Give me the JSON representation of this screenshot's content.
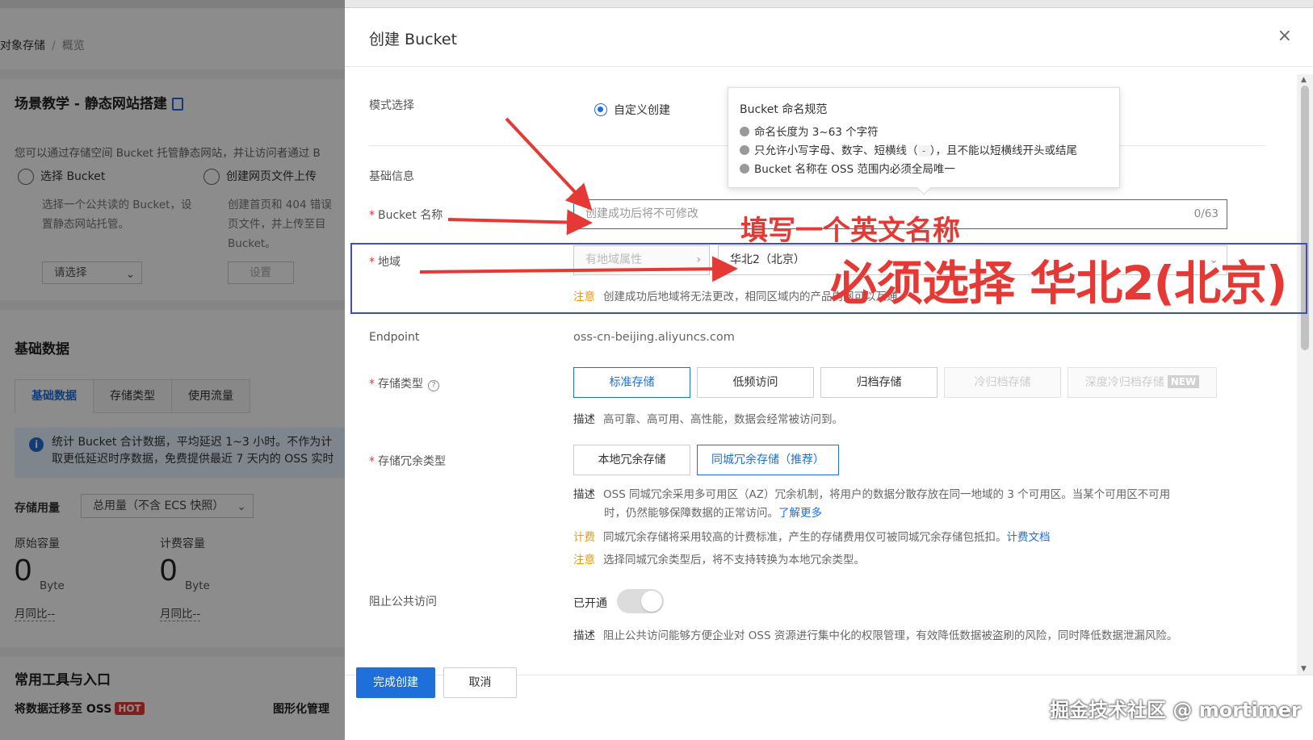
{
  "background": {
    "breadcrumb": {
      "root": "对象存储",
      "current": "概览"
    },
    "scene": {
      "title": "场景教学 - 静态网站搭建",
      "desc": "您可以通过存储空间 Bucket 托管静态网站，并让访问者通过 B",
      "step1": {
        "title": "选择 Bucket",
        "desc1": "选择一个公共读的 Bucket，设",
        "desc2": "置静态网站托管。",
        "button": "请选择"
      },
      "step2": {
        "title": "创建网页文件上传",
        "desc1": "创建首页和 404 错误",
        "desc2": "页文件，并上传至目",
        "desc3": "Bucket。",
        "button": "设置"
      }
    },
    "basic": {
      "title": "基础数据",
      "tabs": [
        "基础数据",
        "存储类型",
        "使用流量"
      ],
      "info1": "统计 Bucket 合计数据，平均延迟 1~3 小时。不作为计",
      "info2": "取更低延迟时序数据，免费提供最近 7 天内的 OSS 实时",
      "usage_label": "存储用量",
      "usage_select": "总用量（不含 ECS 快照）",
      "raw_label": "原始容量",
      "billing_label": "计费容量",
      "raw_value": "0",
      "billing_value": "0",
      "unit": "Byte",
      "mom": "月同比--"
    },
    "tools": {
      "title": "常用工具与入口",
      "item1": "将数据迁移至 OSS",
      "hot": "HOT",
      "item2": "图形化管理"
    }
  },
  "drawer": {
    "title": "创建 Bucket",
    "close": "×",
    "mode": {
      "label": "模式选择",
      "option": "自定义创建"
    },
    "tooltip": {
      "title": "Bucket 命名规范",
      "rule1": "命名长度为 3~63 个字符",
      "rule2a": "只允许小写字母、数字、短横线（",
      "rule2code": "-",
      "rule2b": "），且不能以短横线开头或结尾",
      "rule3": "Bucket 名称在 OSS 范围内必须全局唯一"
    },
    "basic_info": "基础信息",
    "bucket_name": {
      "label": "Bucket 名称",
      "placeholder": "创建成功后将不可修改",
      "count": "0/63"
    },
    "region": {
      "label": "地域",
      "attr_placeholder": "有地域属性",
      "value": "华北2（北京）",
      "note_key": "注意",
      "note": "创建成功后地域将无法更改，相同区域内的产品内网可以互通。"
    },
    "endpoint": {
      "label": "Endpoint",
      "value": "oss-cn-beijing.aliyuncs.com"
    },
    "storage_class": {
      "label": "存储类型",
      "help": "?",
      "options": [
        "标准存储",
        "低频访问",
        "归档存储",
        "冷归档存储",
        "深度冷归档存储"
      ],
      "new_badge": "NEW",
      "desc_key": "描述",
      "desc": "高可靠、高可用、高性能，数据会经常被访问到。"
    },
    "redundancy": {
      "label": "存储冗余类型",
      "options": [
        "本地冗余存储",
        "同城冗余存储（推荐）"
      ],
      "desc_key": "描述",
      "desc1": "OSS 同城冗余采用多可用区（AZ）冗余机制，将用户的数据分散存放在同一地域的 3 个可用区。当某个可用区不可用",
      "desc2": "时，仍然能够保障数据的正常访问。",
      "learn_more": "了解更多",
      "billing_key": "计费",
      "billing": "同城冗余存储将采用较高的计费标准，产生的存储费用仅可被同城冗余存储包抵扣。",
      "billing_link": "计费文档",
      "note_key": "注意",
      "note": "选择同城冗余类型后，将不支持转换为本地冗余类型。"
    },
    "block_public": {
      "label": "阻止公共访问",
      "state": "已开通",
      "desc_key": "描述",
      "desc": "阻止公共访问能够方便企业对 OSS 资源进行集中化的权限管理，有效降低数据被盗刷的风险，同时降低数据泄漏风险。"
    },
    "footer": {
      "confirm": "完成创建",
      "cancel": "取消"
    }
  },
  "annotations": {
    "name_hint": "填写一个英文名称",
    "region_hint": "必须选择 华北2(北京)",
    "arrow_color": "#e53935",
    "box_color": "#3f4fb5"
  },
  "watermark": "掘金技术社区 @ mortimer"
}
